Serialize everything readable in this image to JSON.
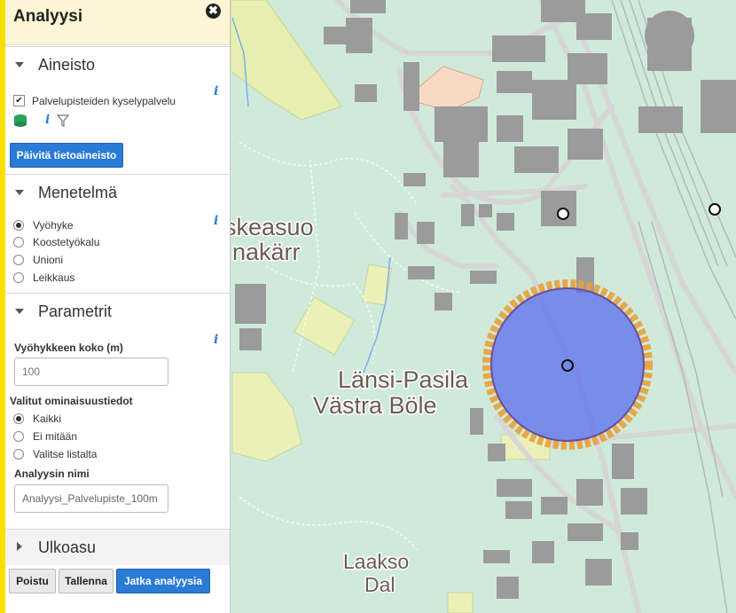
{
  "panel": {
    "title": "Analyysi",
    "close_glyph": "✖",
    "sections": {
      "aineisto": {
        "title": "Aineisto",
        "layer_label": "Palvelupisteiden kyselypalvelu",
        "layer_checked": true,
        "info_glyph": "i",
        "update_button": "Päivitä tietoaineisto"
      },
      "menetelma": {
        "title": "Menetelmä",
        "options": [
          "Vyöhyke",
          "Koostetyökalu",
          "Unioni",
          "Leikkaus"
        ],
        "selected": "Vyöhyke"
      },
      "parametrit": {
        "title": "Parametrit",
        "zone_size_label": "Vyöhykkeen koko (m)",
        "zone_size_placeholder": "100",
        "attributes_label": "Valitut ominaisuustiedot",
        "attribute_options": [
          "Kaikki",
          "Ei mitään",
          "Valitse listalta"
        ],
        "attribute_selected": "Kaikki",
        "name_label": "Analyysin nimi",
        "name_value": "Analyysi_Palvelupiste_100m"
      },
      "ulkoasu": {
        "title": "Ulkoasu"
      }
    },
    "buttons": {
      "remove": "Poistu",
      "save": "Tallenna",
      "continue": "Jatka analyysia"
    }
  },
  "map": {
    "labels": {
      "area1_fi": "skeasuo",
      "area1_sv": "nakärr",
      "area2_fi": "Länsi-Pasila",
      "area2_sv": "Västra Böle",
      "area3_fi": "Laakso",
      "area3_sv": "Dal"
    },
    "colors": {
      "background": "#cfeadb",
      "buffer_fill": "#5a6cf0",
      "buffer_outline": "#e8a13a",
      "building": "#9a9a9a",
      "road": "#d9d9d9",
      "park": "#eaf0b8"
    }
  }
}
